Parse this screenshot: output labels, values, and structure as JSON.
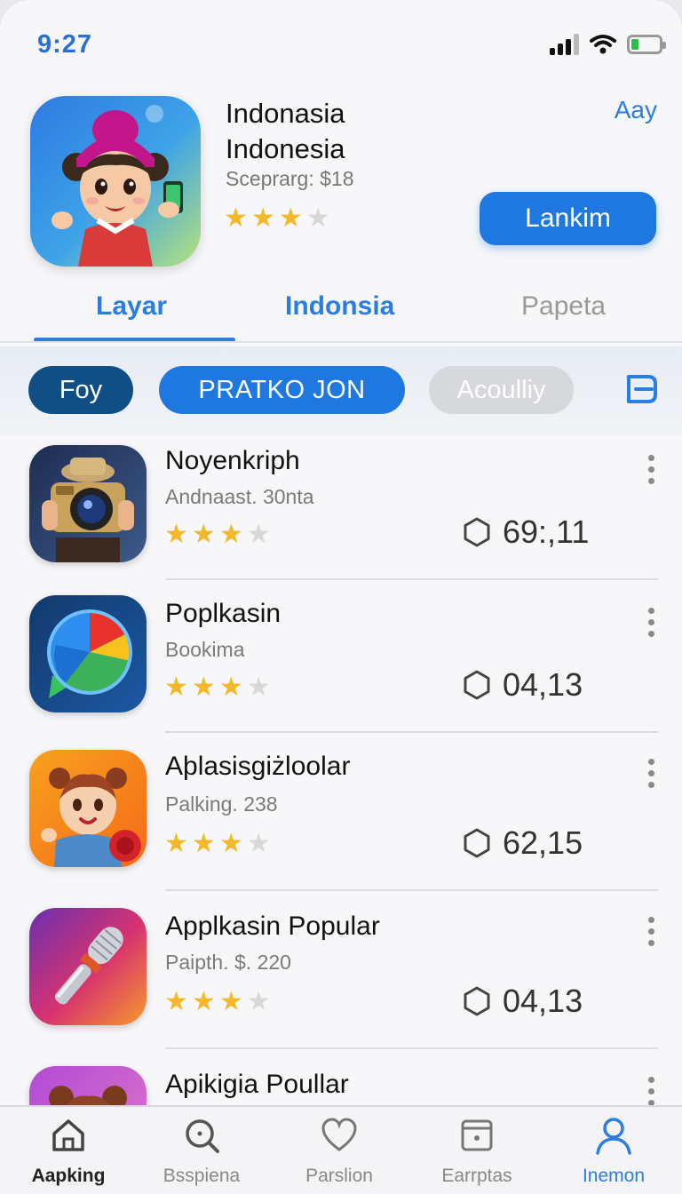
{
  "status_bar": {
    "time": "9:27"
  },
  "hero": {
    "title_line1": "Indonasia",
    "title_line2": "Indonesia",
    "subtitle": "Sceprarg: $18",
    "rating_stars": 3,
    "link_label": "Aay",
    "button_label": "Lankim"
  },
  "tabs": [
    {
      "label": "Layar",
      "selected": true
    },
    {
      "label": "Indonsia",
      "selected": false
    },
    {
      "label": "Papeta",
      "selected": false
    }
  ],
  "chips": [
    {
      "label": "Foy"
    },
    {
      "label": "PRATKO JON"
    },
    {
      "label": "Acoulliy"
    }
  ],
  "apps": [
    {
      "name": "Noyenkriph",
      "subtitle": "Andnaast. 30nta",
      "rating_stars": 3,
      "score": "69:,11",
      "icon": "camera-app-icon"
    },
    {
      "name": "Poplkasin",
      "subtitle": "Bookima",
      "rating_stars": 3,
      "score": "04,13",
      "icon": "chat-pie-app-icon"
    },
    {
      "name": "Aþlasisgiżloolar",
      "subtitle": "Palking. 238",
      "rating_stars": 3,
      "score": "62,15",
      "icon": "girl-megaphone-app-icon"
    },
    {
      "name": "Applkasin Popular",
      "subtitle": "Paipth. $. 220",
      "rating_stars": 3,
      "score": "04,13",
      "icon": "microphone-app-icon"
    },
    {
      "name": "Apikigia Poullar",
      "subtitle": "",
      "rating_stars": 0,
      "score": "",
      "icon": "doll-app-icon"
    }
  ],
  "bottom_nav": [
    {
      "label": "Aapking",
      "icon": "home-icon"
    },
    {
      "label": "Bsspiena",
      "icon": "search-icon"
    },
    {
      "label": "Parslion",
      "icon": "heart-icon"
    },
    {
      "label": "Earrptas",
      "icon": "calendar-icon"
    },
    {
      "label": "Inemon",
      "icon": "profile-icon",
      "active": true
    }
  ],
  "colors": {
    "accent": "#1f78e0",
    "tab_active": "#2a7de1",
    "chip_dark": "#0f4f86",
    "star": "#f4b82a"
  }
}
